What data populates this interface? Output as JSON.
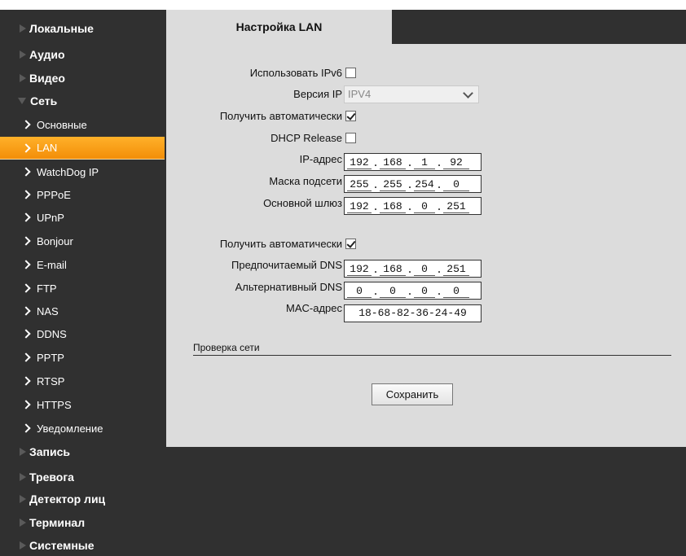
{
  "sidebar": {
    "categories_top": [
      {
        "label": "Локальные"
      },
      {
        "label": "Аудио"
      },
      {
        "label": "Видео"
      },
      {
        "label": "Сеть"
      }
    ],
    "network_items": [
      {
        "label": "Основные"
      },
      {
        "label": "LAN",
        "active": true
      },
      {
        "label": "WatchDog IP"
      },
      {
        "label": "PPPoE"
      },
      {
        "label": "UPnP"
      },
      {
        "label": "Bonjour"
      },
      {
        "label": "E-mail"
      },
      {
        "label": "FTP"
      },
      {
        "label": "NAS"
      },
      {
        "label": "DDNS"
      },
      {
        "label": "PPTP"
      },
      {
        "label": "RTSP"
      },
      {
        "label": "HTTPS"
      },
      {
        "label": "Уведомление"
      }
    ],
    "categories_bottom": [
      {
        "label": "Запись"
      },
      {
        "label": "Тревога"
      },
      {
        "label": "Детектор лиц"
      },
      {
        "label": "Терминал"
      },
      {
        "label": "Системные"
      }
    ]
  },
  "tab": {
    "title": "Настройка LAN"
  },
  "form": {
    "use_ipv6_label": "Использовать IPv6",
    "use_ipv6_checked": false,
    "ip_version_label": "Версия IP",
    "ip_version_value": "IPV4",
    "auto_ip_label": "Получить автоматически",
    "auto_ip_checked": true,
    "dhcp_release_label": "DHCP Release",
    "dhcp_release_checked": false,
    "ip_label": "IP-адрес",
    "ip_value": [
      "192",
      "168",
      "1",
      "92"
    ],
    "mask_label": "Маска подсети",
    "mask_value": [
      "255",
      "255",
      "254",
      "0"
    ],
    "gateway_label": "Основной шлюз",
    "gateway_value": [
      "192",
      "168",
      "0",
      "251"
    ],
    "auto_dns_label": "Получить автоматически",
    "auto_dns_checked": true,
    "preferred_dns_label": "Предпочитаемый DNS",
    "preferred_dns_value": [
      "192",
      "168",
      "0",
      "251"
    ],
    "alt_dns_label": "Альтернативный DNS",
    "alt_dns_value": [
      "0",
      "0",
      "0",
      "0"
    ],
    "mac_label": "MAC-адрес",
    "mac_value": "18-68-82-36-24-49"
  },
  "network_check": {
    "title": "Проверка сети"
  },
  "buttons": {
    "save_label": "Сохранить"
  },
  "colors": {
    "accent": "#f59a12",
    "panel": "#dcdcdc",
    "background": "#303030"
  }
}
